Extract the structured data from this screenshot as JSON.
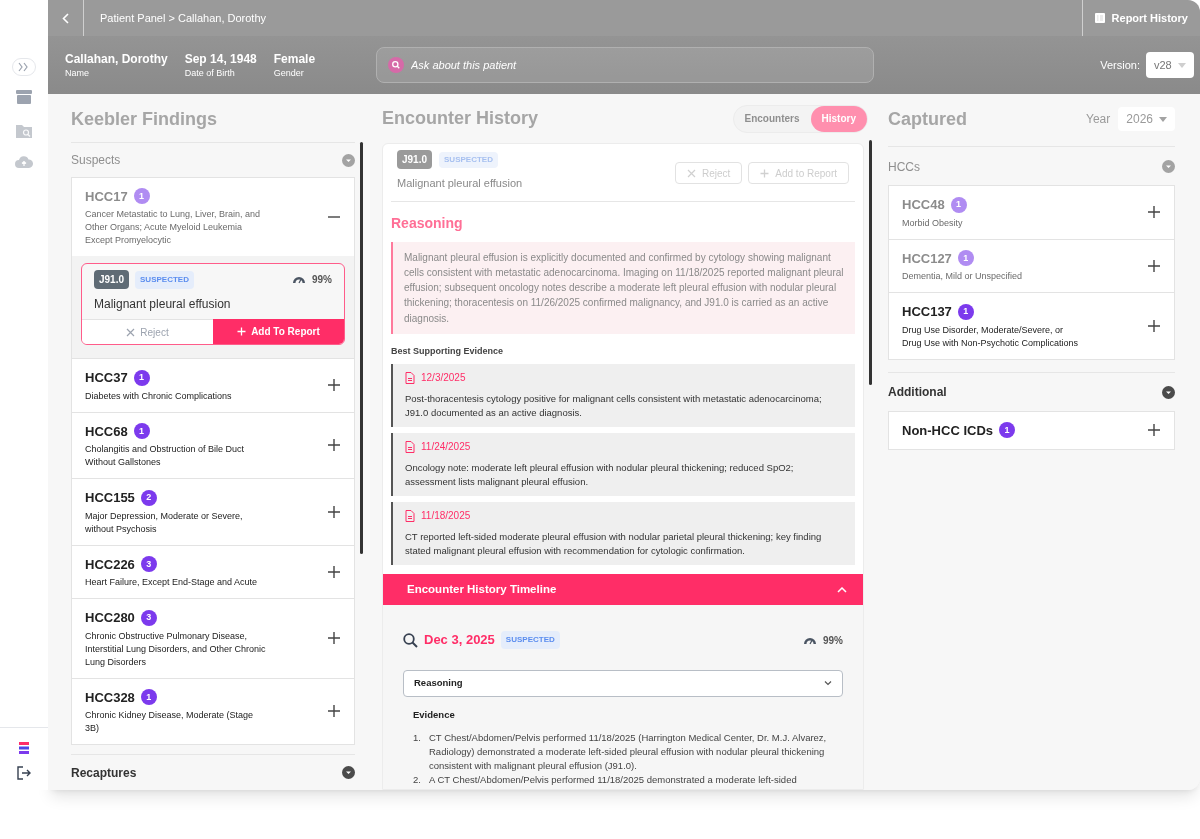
{
  "breadcrumb": "Patient Panel > Callahan, Dorothy",
  "report_history": "Report History",
  "patient": [
    {
      "value": "Callahan, Dorothy",
      "label": "Name"
    },
    {
      "value": "Sep 14, 1948",
      "label": "Date of Birth"
    },
    {
      "value": "Female",
      "label": "Gender"
    }
  ],
  "ask": {
    "placeholder": "Ask about this patient"
  },
  "version": {
    "label": "Version:",
    "value": "v28"
  },
  "findings": {
    "title": "Keebler Findings",
    "sections": [
      {
        "title": "Suspects",
        "items": [
          {
            "code": "HCC17",
            "count": "1",
            "description": "Cancer Metastatic to Lung, Liver, Brain, and Other Organs; Acute Myeloid Leukemia Except Promyelocytic",
            "dimmed": true,
            "expanded": true,
            "detail": {
              "code": "J91.0",
              "status": "SUSPECTED",
              "confidence": "99%",
              "title": "Malignant pleural effusion",
              "buttons": [
                {
                  "kind": "reject",
                  "label": "Reject"
                },
                {
                  "kind": "add",
                  "label": "Add To Report"
                }
              ]
            }
          },
          {
            "code": "HCC37",
            "count": "1",
            "description": "Diabetes with Chronic Complications",
            "dimmed": false,
            "expanded": false
          },
          {
            "code": "HCC68",
            "count": "1",
            "description": "Cholangitis and Obstruction of Bile Duct Without Gallstones",
            "dimmed": false,
            "expanded": false
          },
          {
            "code": "HCC155",
            "count": "2",
            "description": "Major Depression, Moderate or Severe, without Psychosis",
            "dimmed": false,
            "expanded": false
          },
          {
            "code": "HCC226",
            "count": "3",
            "description": "Heart Failure, Except End-Stage and Acute",
            "dimmed": false,
            "expanded": false
          },
          {
            "code": "HCC280",
            "count": "3",
            "description": "Chronic Obstructive Pulmonary Disease, Interstitial Lung Disorders, and Other Chronic Lung Disorders",
            "dimmed": false,
            "expanded": false
          },
          {
            "code": "HCC328",
            "count": "1",
            "description": "Chronic Kidney Disease, Moderate (Stage 3B)",
            "dimmed": false,
            "expanded": false
          }
        ]
      },
      {
        "title": "Recaptures"
      }
    ]
  },
  "encounter": {
    "title": "Encounter History",
    "tabs": [
      {
        "label": "Encounters",
        "selected": false
      },
      {
        "label": "History",
        "selected": true
      }
    ],
    "finding": {
      "code": "J91.0",
      "status": "SUSPECTED",
      "title": "Malignant pleural effusion",
      "buttons": [
        {
          "kind": "reject",
          "label": "Reject",
          "disabled": true
        },
        {
          "kind": "add",
          "label": "Add to Report",
          "disabled": true
        }
      ],
      "reasoning_title": "Reasoning",
      "reasoning": "Malignant pleural effusion is explicitly documented and confirmed by cytology showing malignant cells consistent with metastatic adenocarcinoma. Imaging on 11/18/2025 reported malignant pleural effusion; subsequent oncology notes describe a moderate left pleural effusion with nodular pleural thickening; thoracentesis on 11/26/2025 confirmed malignancy, and J91.0 is carried as an active diagnosis.",
      "evidence_title": "Best Supporting Evidence",
      "evidence": [
        {
          "date": "12/3/2025",
          "text": "Post-thoracentesis cytology positive for malignant cells consistent with metastatic adenocarcinoma; J91.0 documented as an active diagnosis."
        },
        {
          "date": "11/24/2025",
          "text": "Oncology note: moderate left pleural effusion with nodular pleural thickening; reduced SpO2; assessment lists malignant pleural effusion."
        },
        {
          "date": "11/18/2025",
          "text": "CT reported left-sided moderate pleural effusion with nodular parietal pleural thickening; key finding stated malignant pleural effusion with recommendation for cytologic confirmation."
        }
      ]
    },
    "timeline": {
      "title": "Encounter History Timeline",
      "expanded": true,
      "entry": {
        "date": "Dec 3, 2025",
        "status": "SUSPECTED",
        "confidence": "99%",
        "dropdown": {
          "label": "Reasoning",
          "expanded": false
        },
        "evidence_title": "Evidence",
        "evidence": [
          {
            "number": "1.",
            "text": "CT Chest/Abdomen/Pelvis performed 11/18/2025 (Harrington Medical Center, Dr. M.J. Alvarez, Radiology) demonstrated a moderate left-sided pleural effusion with nodular pleural thickening consistent with malignant pleural effusion (J91.0)."
          },
          {
            "number": "2.",
            "text": "A CT Chest/Abdomen/Pelvis performed 11/18/2025 demonstrated a moderate left-sided"
          }
        ]
      }
    }
  },
  "captured": {
    "title": "Captured",
    "year": {
      "label": "Year",
      "value": "2026"
    },
    "sections": [
      {
        "title": "HCCs",
        "items": [
          {
            "code": "HCC48",
            "count": "1",
            "description": "Morbid Obesity",
            "dimmed": true
          },
          {
            "code": "HCC127",
            "count": "1",
            "description": "Dementia, Mild or Unspecified",
            "dimmed": true
          },
          {
            "code": "HCC137",
            "count": "1",
            "description": "Drug Use Disorder, Moderate/Severe, or Drug Use with Non-Psychotic Complications",
            "dimmed": false
          }
        ]
      },
      {
        "title": "Additional",
        "items": [
          {
            "code": "Non-HCC ICDs",
            "count": "1",
            "dimmed": false
          }
        ]
      }
    ]
  }
}
